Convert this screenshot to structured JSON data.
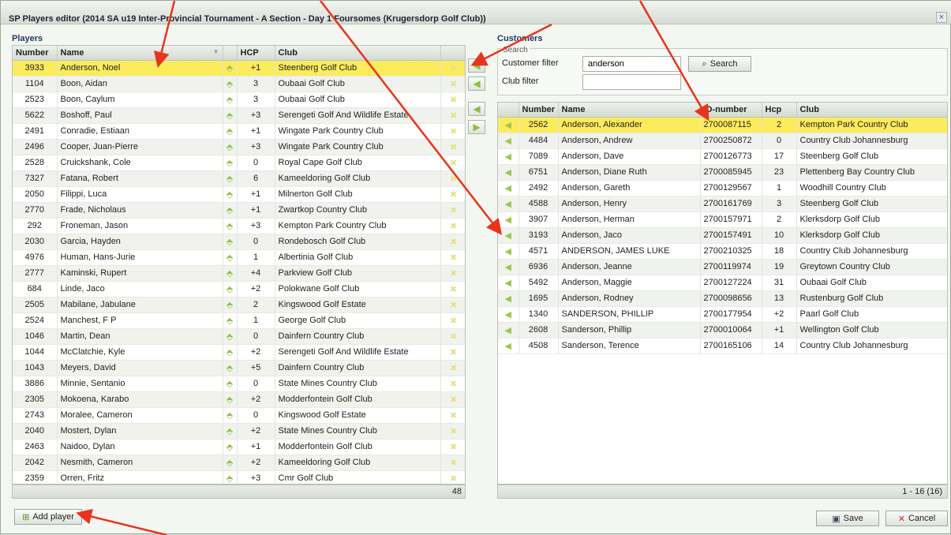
{
  "window": {
    "title": "SP Players editor (2014 SA u19 Inter-Provincial Tournament - A Section - Day 1 Foursomes (Krugersdorp Golf Club))",
    "close": "×"
  },
  "players": {
    "label": "Players",
    "columns": [
      "Number",
      "Name",
      "",
      "HCP",
      "Club",
      ""
    ],
    "count": "48",
    "rows": [
      {
        "number": "3933",
        "name": "Anderson, Noel",
        "hcp": "+1",
        "club": "Steenberg Golf Club",
        "selected": true
      },
      {
        "number": "1104",
        "name": "Boon, Aidan",
        "hcp": "3",
        "club": "Oubaai Golf Club"
      },
      {
        "number": "2523",
        "name": "Boon, Caylum",
        "hcp": "3",
        "club": "Oubaai Golf Club"
      },
      {
        "number": "5622",
        "name": "Boshoff, Paul",
        "hcp": "+3",
        "club": "Serengeti Golf And Wildlife Estate"
      },
      {
        "number": "2491",
        "name": "Conradie, Estiaan",
        "hcp": "+1",
        "club": "Wingate Park Country Club"
      },
      {
        "number": "2496",
        "name": "Cooper, Juan-Pierre",
        "hcp": "+3",
        "club": "Wingate Park Country Club"
      },
      {
        "number": "2528",
        "name": "Cruickshank, Cole",
        "hcp": "0",
        "club": "Royal Cape Golf Club"
      },
      {
        "number": "7327",
        "name": "Fatana, Robert",
        "hcp": "6",
        "club": "Kameeldoring Golf Club"
      },
      {
        "number": "2050",
        "name": "Filippi, Luca",
        "hcp": "+1",
        "club": "Milnerton Golf Club"
      },
      {
        "number": "2770",
        "name": "Frade, Nicholaus",
        "hcp": "+1",
        "club": "Zwartkop Country Club"
      },
      {
        "number": "292",
        "name": "Froneman, Jason",
        "hcp": "+3",
        "club": "Kempton Park Country Club"
      },
      {
        "number": "2030",
        "name": "Garcia, Hayden",
        "hcp": "0",
        "club": "Rondebosch Golf Club"
      },
      {
        "number": "4976",
        "name": "Human, Hans-Jurie",
        "hcp": "1",
        "club": "Albertinia Golf Club"
      },
      {
        "number": "2777",
        "name": "Kaminski, Rupert",
        "hcp": "+4",
        "club": "Parkview Golf Club"
      },
      {
        "number": "684",
        "name": "Linde, Jaco",
        "hcp": "+2",
        "club": "Polokwane Golf Club"
      },
      {
        "number": "2505",
        "name": "Mabilane, Jabulane",
        "hcp": "2",
        "club": "Kingswood Golf Estate"
      },
      {
        "number": "2524",
        "name": "Manchest, F P",
        "hcp": "1",
        "club": "George Golf Club"
      },
      {
        "number": "1046",
        "name": "Martin, Dean",
        "hcp": "0",
        "club": "Dainfern Country Club"
      },
      {
        "number": "1044",
        "name": "McClatchie, Kyle",
        "hcp": "+2",
        "club": "Serengeti Golf And Wildlife Estate"
      },
      {
        "number": "1043",
        "name": "Meyers, David",
        "hcp": "+5",
        "club": "Dainfern Country Club"
      },
      {
        "number": "3886",
        "name": "Minnie, Sentanio",
        "hcp": "0",
        "club": "State Mines Country Club"
      },
      {
        "number": "2305",
        "name": "Mokoena, Karabo",
        "hcp": "+2",
        "club": "Modderfontein Golf Club"
      },
      {
        "number": "2743",
        "name": "Moralee, Cameron",
        "hcp": "0",
        "club": "Kingswood Golf Estate"
      },
      {
        "number": "2040",
        "name": "Mostert, Dylan",
        "hcp": "+2",
        "club": "State Mines Country Club"
      },
      {
        "number": "2463",
        "name": "Naidoo, Dylan",
        "hcp": "+1",
        "club": "Modderfontein Golf Club"
      },
      {
        "number": "2042",
        "name": "Nesmith, Cameron",
        "hcp": "+2",
        "club": "Kameeldoring Golf Club"
      },
      {
        "number": "2359",
        "name": "Orren, Fritz",
        "hcp": "+3",
        "club": "Cmr Golf Club"
      }
    ]
  },
  "customers": {
    "label": "Customers",
    "search_legend": "Search",
    "filter_label": "Customer filter",
    "filter_value": "anderson",
    "club_filter_label": "Club filter",
    "club_filter_value": "",
    "search_button": "Search",
    "columns": [
      "",
      "Number",
      "Name",
      "ID-number",
      "Hcp",
      "Club"
    ],
    "paging": "1 - 16 (16)",
    "rows": [
      {
        "number": "2562",
        "name": "Anderson, Alexander",
        "id": "2700087115",
        "hcp": "2",
        "club": "Kempton Park Country Club",
        "selected": true
      },
      {
        "number": "4484",
        "name": "Anderson, Andrew",
        "id": "2700250872",
        "hcp": "0",
        "club": "Country Club Johannesburg"
      },
      {
        "number": "7089",
        "name": "Anderson, Dave",
        "id": "2700126773",
        "hcp": "17",
        "club": "Steenberg Golf Club"
      },
      {
        "number": "6751",
        "name": "Anderson, Diane Ruth",
        "id": "2700085945",
        "hcp": "23",
        "club": "Plettenberg Bay Country Club"
      },
      {
        "number": "2492",
        "name": "Anderson, Gareth",
        "id": "2700129567",
        "hcp": "1",
        "club": "Woodhill Country Club"
      },
      {
        "number": "4588",
        "name": "Anderson, Henry",
        "id": "2700161769",
        "hcp": "3",
        "club": "Steenberg Golf Club"
      },
      {
        "number": "3907",
        "name": "Anderson, Herman",
        "id": "2700157971",
        "hcp": "2",
        "club": "Klerksdorp Golf Club"
      },
      {
        "number": "3193",
        "name": "Anderson, Jaco",
        "id": "2700157491",
        "hcp": "10",
        "club": "Klerksdorp Golf Club"
      },
      {
        "number": "4571",
        "name": "ANDERSON, JAMES LUKE",
        "id": "2700210325",
        "hcp": "18",
        "club": "Country Club Johannesburg"
      },
      {
        "number": "6936",
        "name": "Anderson, Jeanne",
        "id": "2700119974",
        "hcp": "19",
        "club": "Greytown Country Club"
      },
      {
        "number": "5492",
        "name": "Anderson, Maggie",
        "id": "2700127224",
        "hcp": "31",
        "club": "Oubaai Golf Club"
      },
      {
        "number": "1695",
        "name": "Anderson, Rodney",
        "id": "2700098656",
        "hcp": "13",
        "club": "Rustenburg Golf Club"
      },
      {
        "number": "1340",
        "name": "SANDERSON, PHILLIP",
        "id": "2700177954",
        "hcp": "+2",
        "club": "Paarl Golf Club"
      },
      {
        "number": "2608",
        "name": "Sanderson, Phillip",
        "id": "2700010064",
        "hcp": "+1",
        "club": "Wellington Golf Club"
      },
      {
        "number": "4508",
        "name": "Sanderson, Terence",
        "id": "2700165106",
        "hcp": "14",
        "club": "Country Club Johannesburg"
      }
    ]
  },
  "footer": {
    "add_player": "Add player",
    "save": "Save",
    "cancel": "Cancel"
  },
  "colors": {
    "selected_row": "#fbec5d",
    "annotation_arrow": "#e8341c",
    "accent_green": "#8bc34a"
  },
  "icons": {
    "pin": "pin-icon",
    "delete": "delete-icon",
    "arrow_left": "arrow-left-icon",
    "arrow_right": "arrow-right-icon",
    "search": "search-icon",
    "add_player": "add-player-icon",
    "save": "save-icon",
    "cancel": "cancel-icon"
  }
}
